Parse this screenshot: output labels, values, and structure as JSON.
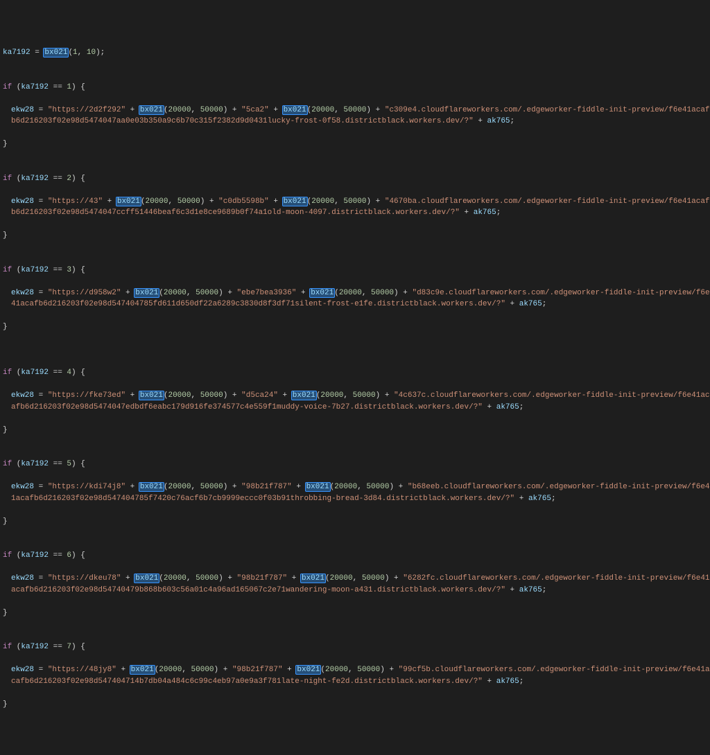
{
  "header": {
    "assign_var": "ka7192",
    "eq": " = ",
    "fn": "bx021",
    "args": "(1, 10);"
  },
  "keywords": {
    "if": "if"
  },
  "common": {
    "cond_var": "ka7192",
    "eqeq": " == ",
    "assign_target": "ekw28",
    "eq": " = ",
    "https": "\"https://",
    "plus": " + ",
    "fn": "bx021",
    "args_a": "(",
    "argn1": "20000",
    "comma": ", ",
    "argn2": "50000",
    "args_b": ")",
    "tail_var": "ak765",
    "semi": ";",
    "open": ") {",
    "close": "}",
    "paren_open": " (",
    "cond_close": ")"
  },
  "blocks": [
    {
      "n": "1",
      "s1": "2d2f292\"",
      "s2": "\"5ca2\"",
      "s3": "\"c309e4.cloudflareworkers.com/.edgeworker-fiddle-init-preview/f6e41acafb6d216203f02e98d5474047aa0e03b350a9c6b70c315f2382d9d0431lucky-frost-0f58.districtblack.workers.dev/?\""
    },
    {
      "n": "2",
      "s1": "43\"",
      "s2": "\"c0db5598b\"",
      "s3": "\"4670ba.cloudflareworkers.com/.edgeworker-fiddle-init-preview/f6e41acafb6d216203f02e98d5474047ccff51446beaf6c3d1e8ce9689b0f74a1old-moon-4097.districtblack.workers.dev/?\""
    },
    {
      "n": "3",
      "s1": "d958w2\"",
      "s2": "\"ebe7bea3936\"",
      "s3": "\"d83c9e.cloudflareworkers.com/.edgeworker-fiddle-init-preview/f6e41acafb6d216203f02e98d547404785fd611d650df22a6289c3830d8f3df71silent-frost-e1fe.districtblack.workers.dev/?\""
    },
    {
      "n": "4",
      "s1": "fke73ed\"",
      "s2": "\"d5ca24\"",
      "s3": "\"4c637c.cloudflareworkers.com/.edgeworker-fiddle-init-preview/f6e41acafb6d216203f02e98d5474047edbdf6eabc179d916fe374577c4e559f1muddy-voice-7b27.districtblack.workers.dev/?\""
    },
    {
      "n": "5",
      "s1": "kdi74j8\"",
      "s2": "\"98b21f787\"",
      "s3": "\"b68eeb.cloudflareworkers.com/.edgeworker-fiddle-init-preview/f6e41acafb6d216203f02e98d547404785f7420c76acf6b7cb9999eccc0f03b91throbbing-bread-3d84.districtblack.workers.dev/?\""
    },
    {
      "n": "6",
      "s1": "dkeu78\"",
      "s2": "\"98b21f787\"",
      "s3": "\"6282fc.cloudflareworkers.com/.edgeworker-fiddle-init-preview/f6e41acafb6d216203f02e98d54740479b868b603c56a01c4a96ad165067c2e71wandering-moon-a431.districtblack.workers.dev/?\""
    },
    {
      "n": "7",
      "s1": "48jy8\"",
      "s2": "\"98b21f787\"",
      "s3": "\"99cf5b.cloudflareworkers.com/.edgeworker-fiddle-init-preview/f6e41acafb6d216203f02e98d547404714b7db04a484c6c99c4eb97a0e9a3f781late-night-fe2d.districtblack.workers.dev/?\""
    }
  ]
}
